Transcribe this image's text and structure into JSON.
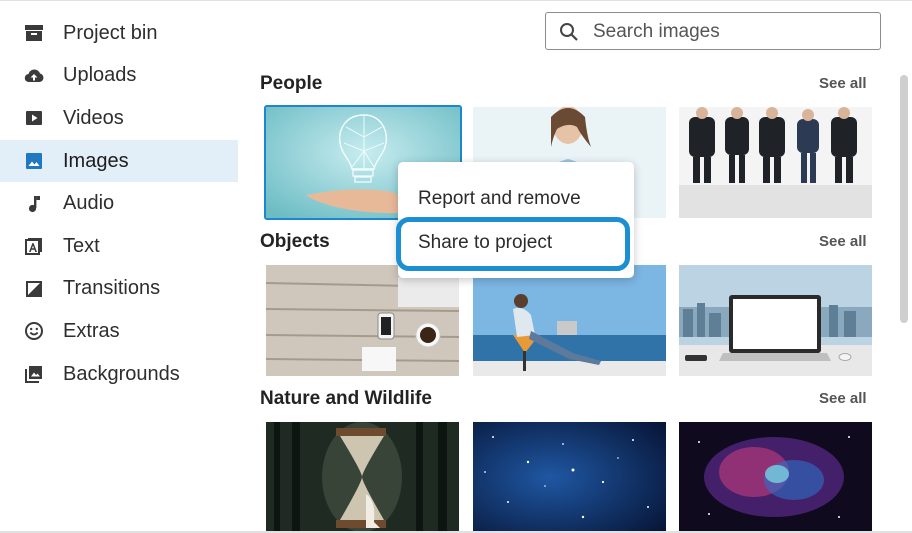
{
  "sidebar": {
    "items": [
      {
        "label": "Project bin",
        "icon": "archive-icon"
      },
      {
        "label": "Uploads",
        "icon": "cloud-upload-icon"
      },
      {
        "label": "Videos",
        "icon": "video-icon"
      },
      {
        "label": "Images",
        "icon": "image-icon",
        "active": true
      },
      {
        "label": "Audio",
        "icon": "music-note-icon"
      },
      {
        "label": "Text",
        "icon": "text-icon"
      },
      {
        "label": "Transitions",
        "icon": "transition-icon"
      },
      {
        "label": "Extras",
        "icon": "smiley-icon"
      },
      {
        "label": "Backgrounds",
        "icon": "backgrounds-icon"
      }
    ]
  },
  "search": {
    "placeholder": "Search images"
  },
  "sections": [
    {
      "title": "People",
      "see_all": "See all"
    },
    {
      "title": "Objects",
      "see_all": "See all"
    },
    {
      "title": "Nature and Wildlife",
      "see_all": "See all"
    }
  ],
  "context_menu": {
    "items": [
      "Report and remove",
      "Share to project"
    ],
    "highlighted": "Share to project"
  },
  "colors": {
    "accent": "#1d86cc",
    "active_bg": "#e2eef8",
    "highlight_ring": "#1c8fd2"
  }
}
